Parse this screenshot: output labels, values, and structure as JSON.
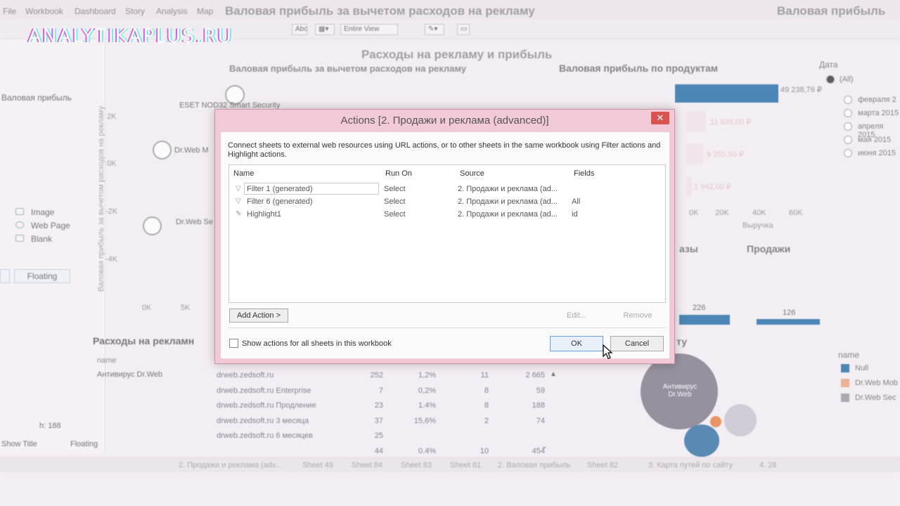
{
  "watermark": "ANALYTIKAPLUS.RU",
  "toolbar": {
    "view_select": "Entire View"
  },
  "background": {
    "sheet_title_main": "Расходы на рекламу и прибыль",
    "sheet_title_right": "Валовая прибыль",
    "scatter_title": "Валовая прибыль за вычетом расходов на рекламу",
    "scatter_axis_label": "Валовая прибыль за вычетом расходов на рекламу",
    "scatter_y_ticks": [
      "2K",
      "0K",
      "-2K",
      "-4K"
    ],
    "scatter_x_ticks": [
      "0K",
      "5K"
    ],
    "scatter_labels": [
      "ESET NOD32 Smart Security",
      "Dr.Web M",
      "Dr.Web Se"
    ],
    "gross_title": "Валовая прибыль по продуктам",
    "gross_top_value": "49 238,76 ₽",
    "gross_values": [
      "11 639,00 ₽",
      "9 255,50 ₽",
      "1 942,00 ₽"
    ],
    "gross_x_ticks": [
      "0K",
      "20K",
      "40K",
      "60K"
    ],
    "gross_xlabel": "Выручка",
    "date_legend_title": "Дата",
    "date_legend_items": [
      "(All)",
      "февраля 2",
      "марта 2015",
      "апреля 2015",
      "мая 2015",
      "июня 2015"
    ],
    "left_label_profit": "Валовая прибыль",
    "left_items": [
      "Image",
      "Web Page",
      "Blank"
    ],
    "floating_button": "Floating",
    "floating_label": "Floating",
    "show_title_label": "Show Title",
    "height_field": "h: 188",
    "sales_title": "Продажи",
    "sales_partial_title": "азы",
    "sales_values": [
      "226",
      "126"
    ],
    "bubble_title": "ту",
    "bubble_label": "Антивирус Dr.Web",
    "name_legend_title": "name",
    "name_legend_items": [
      "Null",
      "Dr.Web Mob",
      "Dr.Web Sec"
    ],
    "table_title": "Расходы на рекламн",
    "table_header": "name",
    "table_group": "Антивирус Dr.Web",
    "table_rows": [
      [
        "drweb.zedsoft.ru",
        "252",
        "1,2%",
        "11",
        "2 665"
      ],
      [
        "drweb.zedsoft.ru Enterprise",
        "7",
        "0,2%",
        "8",
        "59"
      ],
      [
        "drweb.zedsoft.ru Продление",
        "23",
        "1.4%",
        "8",
        "188"
      ],
      [
        "drweb.zedsoft.ru 3 месяца",
        "37",
        "15,6%",
        "2",
        "74"
      ],
      [
        "drweb.zedsoft.ru 6 месяцев",
        "25",
        "",
        "",
        ""
      ],
      [
        "",
        "44",
        "0.4%",
        "10",
        "454"
      ]
    ],
    "tabs": [
      "2. Продажи и реклама (adv...",
      "Sheet 49",
      "Sheet 84",
      "Sheet 83",
      "Sheet 81",
      "2. Валовая прибыль",
      "Sheet 82",
      "3. Карта путей по сайту",
      "4. 28"
    ]
  },
  "dialog": {
    "title": "Actions [2. Продажи и реклама (advanced)]",
    "close": "✕",
    "description": "Connect sheets to external web resources using URL actions, or to other sheets in the same workbook using Filter actions and Highlight actions.",
    "columns": [
      "Name",
      "Run On",
      "Source",
      "Fields"
    ],
    "rows": [
      {
        "icon": "filter-icon",
        "name": "Filter 1 (generated)",
        "run_on": "Select",
        "source": "2. Продажи и реклама (ad...",
        "fields": ""
      },
      {
        "icon": "filter-icon",
        "name": "Filter 6 (generated)",
        "run_on": "Select",
        "source": "2. Продажи и реклама (ad...",
        "fields": "All"
      },
      {
        "icon": "highlight-icon",
        "name": "Highlight1",
        "run_on": "Select",
        "source": "2. Продажи и реклама (ad...",
        "fields": "id"
      }
    ],
    "add_action": "Add Action >",
    "edit": "Edit...",
    "remove": "Remove",
    "show_all_label": "Show actions for all sheets in this workbook",
    "ok": "OK",
    "cancel": "Cancel"
  },
  "colors": {
    "dialog_frame": "#f2c9d7",
    "close_button": "#d9534f",
    "bar_blue": "#1d6aa6"
  }
}
